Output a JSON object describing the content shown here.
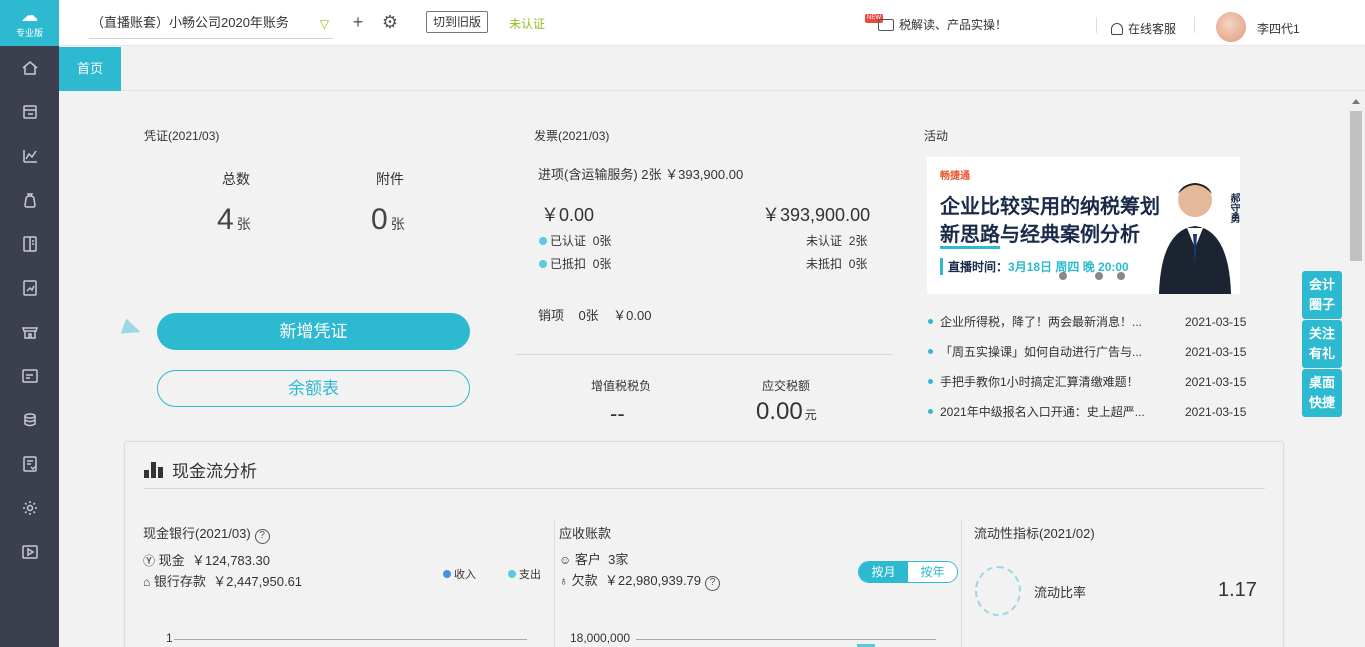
{
  "app": {
    "logo_text": "专业版",
    "account": "（直播账套）小畅公司2020年账务",
    "switch_old": "切到旧版",
    "cert_status": "未认证",
    "new_badge": "NEW",
    "news_link": "税解读、产品实操！",
    "service": "在线客服",
    "username": "李四代1"
  },
  "tabs": [
    {
      "label": "首页"
    }
  ],
  "sidebar_icons": [
    "home-icon",
    "voucher-icon",
    "report-icon",
    "money-bag-icon",
    "ledger-icon",
    "tax-icon",
    "shop-icon",
    "asset-icon",
    "salary-icon",
    "invoice-icon",
    "settings-icon",
    "video-icon"
  ],
  "voucher": {
    "title": "凭证(2021/03)",
    "total_label": "总数",
    "total_value": "4",
    "total_unit": "张",
    "attach_label": "附件",
    "attach_value": "0",
    "attach_unit": "张",
    "new_btn": "新增凭证",
    "balance_btn": "余额表"
  },
  "invoice": {
    "title": "发票(2021/03)",
    "in_line": "进项(含运输服务) 2张 ￥393,900.00",
    "amt_left": "￥0.00",
    "amt_right": "￥393,900.00",
    "certified": "已认证",
    "certified_val": "0张",
    "uncertified": "未认证",
    "uncertified_val": "2张",
    "deducted": "已抵扣",
    "deducted_val": "0张",
    "undeducted": "未抵扣",
    "undeducted_val": "0张",
    "out_line": "销项    0张    ￥0.00",
    "vat_label": "增值税税负",
    "vat_value": "--",
    "tax_due_label": "应交税额",
    "tax_due_value": "0.00",
    "tax_due_unit": "元"
  },
  "activity": {
    "title": "活动",
    "banner_brand": "畅捷通",
    "banner_line1": "企业比较实用的纳税筹划",
    "banner_line2a": "新思路",
    "banner_line2b": "与经典案例分析",
    "banner_live_label": "直播时间：",
    "banner_live_time": "3月18日 周四 晚 20:00",
    "banner_person": "郝守勇",
    "news": [
      {
        "title": "企业所得税，降了！两会最新消息！...",
        "date": "2021-03-15"
      },
      {
        "title": "「周五实操课」如何自动进行广告与...",
        "date": "2021-03-15"
      },
      {
        "title": "手把手教你1小时搞定汇算清缴难题！",
        "date": "2021-03-15"
      },
      {
        "title": "2021年中级报名入口开通：史上超严...",
        "date": "2021-03-15"
      }
    ]
  },
  "float_tools": [
    "会计圈子",
    "关注有礼",
    "桌面快捷"
  ],
  "cashflow": {
    "title": "现金流分析",
    "bank_title": "现金银行(2021/03)",
    "cash_label": "现金",
    "cash_value": "￥124,783.30",
    "deposit_label": "银行存款",
    "deposit_value": "￥2,447,950.61",
    "legend_in": "收入",
    "legend_out": "支出",
    "axis_top_left": "1",
    "recv_title": "应收账款",
    "customer_label": "客户",
    "customer_value": "3家",
    "owed_label": "欠款",
    "owed_value": "￥22,980,939.79",
    "toggle_month": "按月",
    "toggle_year": "按年",
    "axis_top_mid": "18,000,000",
    "liq_title": "流动性指标(2021/02)",
    "liq_label": "流动比率",
    "liq_value": "1.17"
  },
  "colors": {
    "accent": "#2dbad0",
    "sidebar": "#3c3f4e",
    "green": "#8dc21f"
  }
}
